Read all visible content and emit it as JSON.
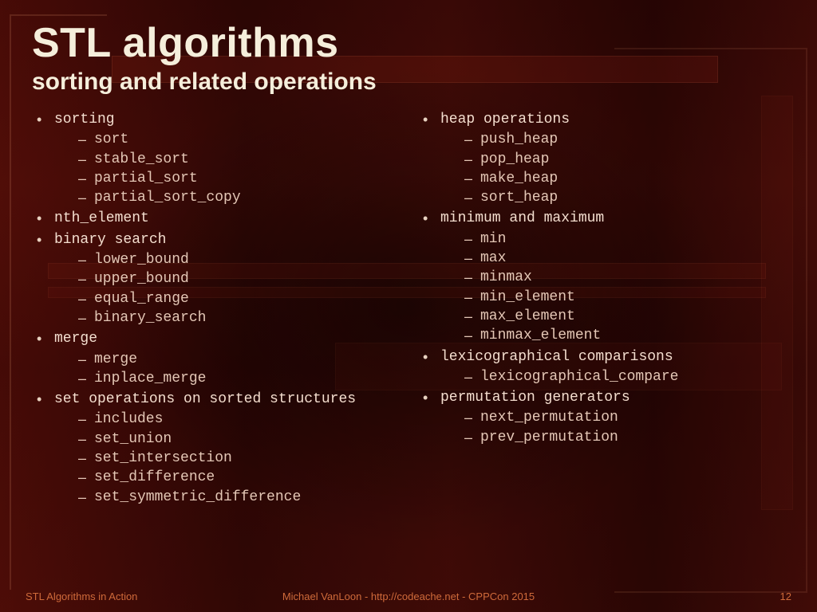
{
  "title": "STL algorithms",
  "subtitle": "sorting and related operations",
  "columns": {
    "left": [
      {
        "label": "sorting",
        "sub": [
          "sort",
          "stable_sort",
          "partial_sort",
          "partial_sort_copy"
        ]
      },
      {
        "label": "nth_element",
        "sub": []
      },
      {
        "label": "binary search",
        "sub": [
          "lower_bound",
          "upper_bound",
          "equal_range",
          "binary_search"
        ]
      },
      {
        "label": "merge",
        "sub": [
          "merge",
          "inplace_merge"
        ]
      },
      {
        "label": "set operations on sorted structures",
        "sub": [
          "includes",
          "set_union",
          "set_intersection",
          "set_difference",
          "set_symmetric_difference"
        ]
      }
    ],
    "right": [
      {
        "label": "heap operations",
        "sub": [
          "push_heap",
          "pop_heap",
          "make_heap",
          "sort_heap"
        ]
      },
      {
        "label": "minimum and maximum",
        "sub": [
          "min",
          "max",
          "minmax",
          "min_element",
          "max_element",
          "minmax_element"
        ]
      },
      {
        "label": "lexicographical comparisons",
        "sub": [
          "lexicographical_compare"
        ]
      },
      {
        "label": "permutation generators",
        "sub": [
          "next_permutation",
          "prev_permutation"
        ]
      }
    ]
  },
  "footer": {
    "left": "STL Algorithms in Action",
    "center": "Michael VanLoon - http://codeache.net - CPPCon 2015",
    "page": "12"
  }
}
